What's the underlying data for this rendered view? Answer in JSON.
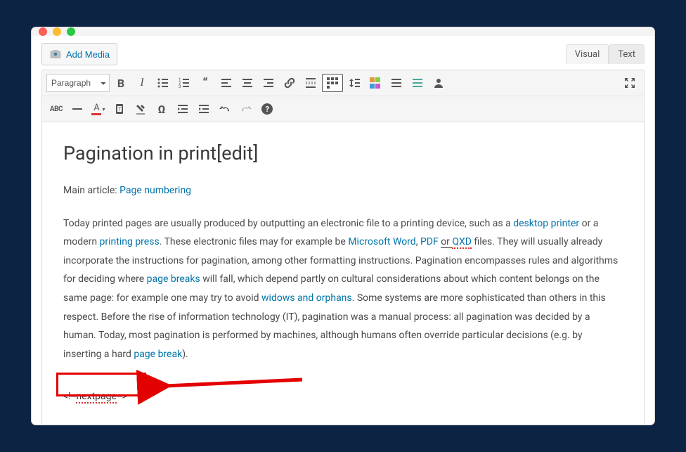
{
  "buttons": {
    "add_media": "Add Media"
  },
  "tabs": {
    "visual": "Visual",
    "text": "Text"
  },
  "format_select": "Paragraph",
  "content": {
    "heading": "Pagination in print[edit]",
    "main_article_prefix": "Main article: ",
    "main_article_link": "Page numbering",
    "p_start": "Today printed pages are usually produced by outputting an electronic file to a printing device, such as a ",
    "link_desktop_printer": "desktop printer",
    "p_or_modern": " or a modern ",
    "link_printing_press": "printing press",
    "p_these_files": ". These electronic files may for example be ",
    "link_ms_word": "Microsoft Word",
    "p_comma1": ", ",
    "link_pdf": "PDF",
    "p_or": " or ",
    "link_qxd": "QXD",
    "p_files_will": " files. They will usually already incorporate the instructions for pagination, among other formatting instructions. Pagination encompasses rules and algorithms for deciding where ",
    "link_page_breaks": "page breaks",
    "p_will_fall": " will fall, which depend partly on cultural considerations about which content belongs on the same page: for example one may try to avoid ",
    "link_widows": "widows and orphans",
    "p_some_systems": ". Some systems are more sophisticated than others in this respect. Before the rise of information technology (IT), pagination was a manual process: all pagination was decided by a human. Today, most pagination is performed by machines, although humans often override particular decisions (e.g. by inserting a hard ",
    "link_page_break": "page break",
    "p_end": ").",
    "nextpage_pre": "<!--",
    "nextpage_mid": "nextpage",
    "nextpage_post": "-->"
  }
}
